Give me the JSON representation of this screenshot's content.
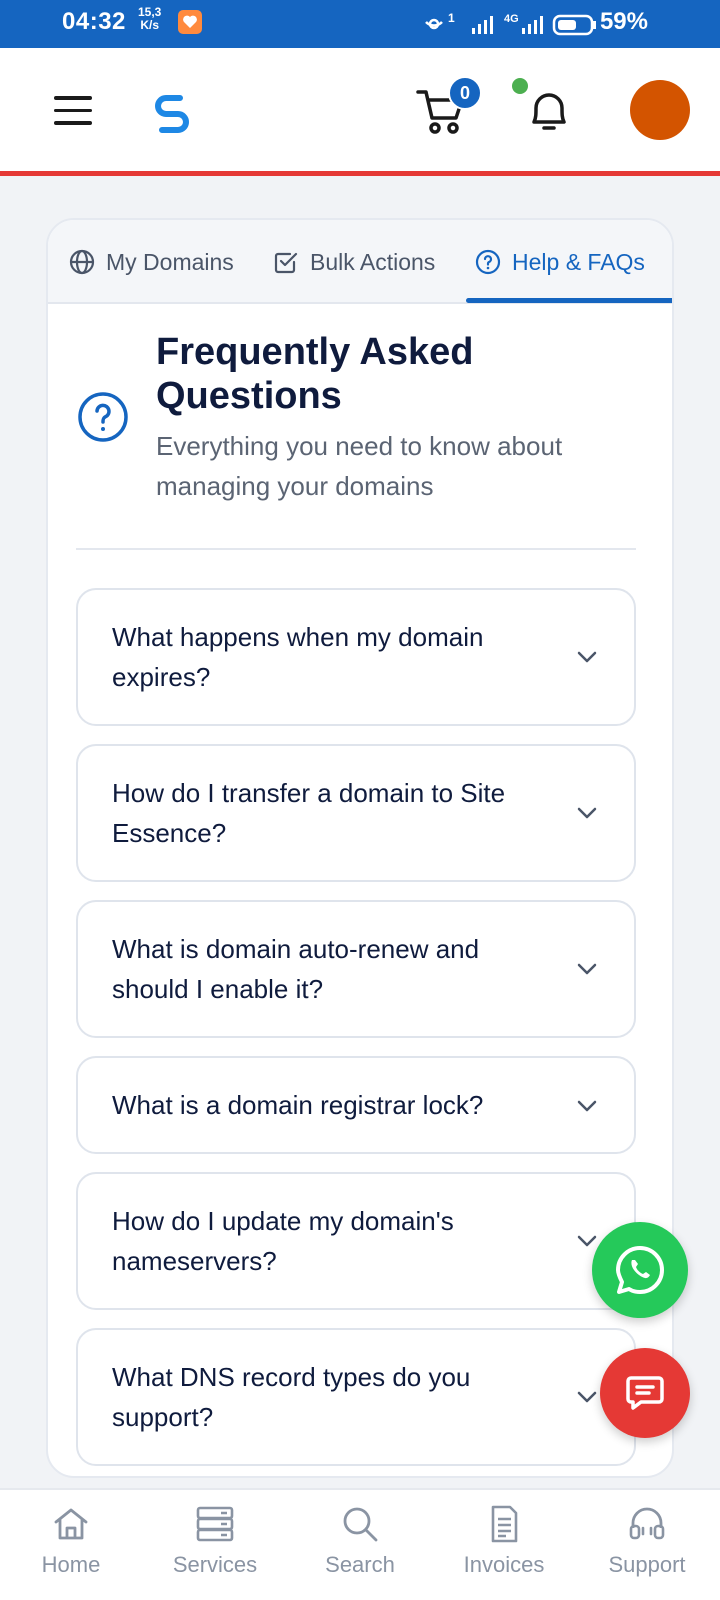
{
  "status_bar": {
    "time": "04:32",
    "net_speed_top": "15,3",
    "net_speed_bottom": "K/s",
    "battery": "59%"
  },
  "header": {
    "cart_count": "0",
    "brand_color": "#1e88e5",
    "accent_color": "#e53935",
    "avatar_color": "#d35400"
  },
  "tabs": [
    {
      "label": "My Domains",
      "icon": "globe-icon"
    },
    {
      "label": "Bulk Actions",
      "icon": "checkbox-icon"
    },
    {
      "label": "Help & FAQs",
      "icon": "help-circle-icon",
      "active": true
    }
  ],
  "faq": {
    "title": "Frequently Asked Questions",
    "subtitle": "Everything you need to know about managing your domains",
    "items": [
      {
        "question": "What happens when my domain expires?"
      },
      {
        "question": "How do I transfer a domain to Site Essence?"
      },
      {
        "question": "What is domain auto-renew and should I enable it?"
      },
      {
        "question": "What is a domain registrar lock?"
      },
      {
        "question": "How do I update my domain's nameservers?"
      },
      {
        "question": "What DNS record types do you support?"
      }
    ]
  },
  "bottom_nav": [
    {
      "label": "Home",
      "icon": "home-icon"
    },
    {
      "label": "Services",
      "icon": "server-icon"
    },
    {
      "label": "Search",
      "icon": "search-icon"
    },
    {
      "label": "Invoices",
      "icon": "invoice-icon"
    },
    {
      "label": "Support",
      "icon": "headset-icon"
    }
  ]
}
